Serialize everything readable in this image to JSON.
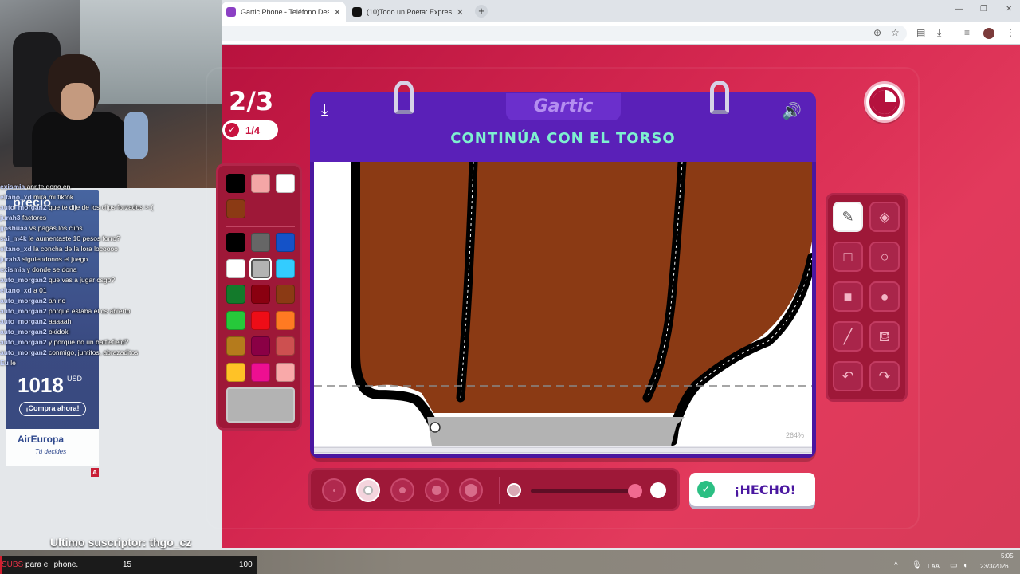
{
  "browser": {
    "tabs": [
      {
        "title": "Gartic Phone - Teléfono Descor",
        "active": true
      },
      {
        "title": "(10)Todo un Poeta: Expresión y",
        "active": false
      }
    ],
    "new_tab": "+",
    "close": "✕"
  },
  "game": {
    "round": "2/3",
    "progress": "1/4",
    "logo": "Gartic",
    "instruction": "CONTINÚA CON EL TORSO",
    "zoom": "264%",
    "done_label": "¡HECHO!",
    "selected_color": "#b3b3b3",
    "palette_recent": [
      "#000000",
      "#f4a6a6",
      "#ffffff",
      "#8b3a14"
    ],
    "palette": [
      "#000000",
      "#666666",
      "#1452c8",
      "#ffffff",
      "#b3b3b3",
      "#33ccff",
      "#137a2b",
      "#8a0010",
      "#8b3a14",
      "#26c93a",
      "#ee0d17",
      "#ff7a22",
      "#b57b1c",
      "#8a0045",
      "#cd5050",
      "#ffc226",
      "#ee0f91",
      "#f9a9a9"
    ],
    "tools": [
      "pencil",
      "eraser",
      "rectangle-outline",
      "circle-outline",
      "rectangle-fill",
      "circle-fill",
      "line",
      "fill-bucket",
      "undo",
      "redo"
    ],
    "selected_tool": "pencil",
    "brush_sizes": 5,
    "selected_brush_size": 2
  },
  "chat": [
    {
      "user": "exismia",
      "msg": "anr te dono en"
    },
    {
      "user": "eltano_xd",
      "msg": "mira mi tiktok"
    },
    {
      "user": "auto_morgan2",
      "msg": "que te dije de los clips forzados >:("
    },
    {
      "user": "jurah3",
      "msg": "factores"
    },
    {
      "user": "jjoshuaa",
      "msg": "vs pagas los clips"
    },
    {
      "user": "sai_m4k",
      "msg": "le aumentaste 10 pesos forro?"
    },
    {
      "user": "eltano_xd",
      "msg": "la concha de la lora locoooo"
    },
    {
      "user": "jurah3",
      "msg": "siguiendonos el juego"
    },
    {
      "user": "exismia",
      "msg": "y donde se dona"
    },
    {
      "user": "auto_morgan2",
      "msg": "que vas a jugar csgo?"
    },
    {
      "user": "eltano_xd",
      "msg": "a 01"
    },
    {
      "user": "auto_morgan2",
      "msg": "ah no"
    },
    {
      "user": "auto_morgan2",
      "msg": "porque estaba el cs abierto"
    },
    {
      "user": "auto_morgan2",
      "msg": "aaaaah"
    },
    {
      "user": "auto_morgan2",
      "msg": "okidoki"
    },
    {
      "user": "auto_morgan2",
      "msg": "y porque no un battlefield?"
    },
    {
      "user": "auto_morgan2",
      "msg": "conmigo, juntitos, abrazaditos"
    },
    {
      "user": "Eu",
      "msg": "le"
    }
  ],
  "ad": {
    "headline": "precio",
    "price": "1018",
    "currency": "USD",
    "cta": "¡Compra ahora!",
    "brand": "AirEuropa",
    "slogan": "Tú decides",
    "badge": "A"
  },
  "stream": {
    "last_sub_label": "Ultimo suscriptor: thgo_cz",
    "subs_goal_prefix": "SUBS",
    "subs_goal_text": " para el iphone.",
    "subs_current": "15",
    "subs_target": "100"
  },
  "taskbar": {
    "lang": "LAA",
    "time": "5:05",
    "date": "23/3/2026"
  }
}
